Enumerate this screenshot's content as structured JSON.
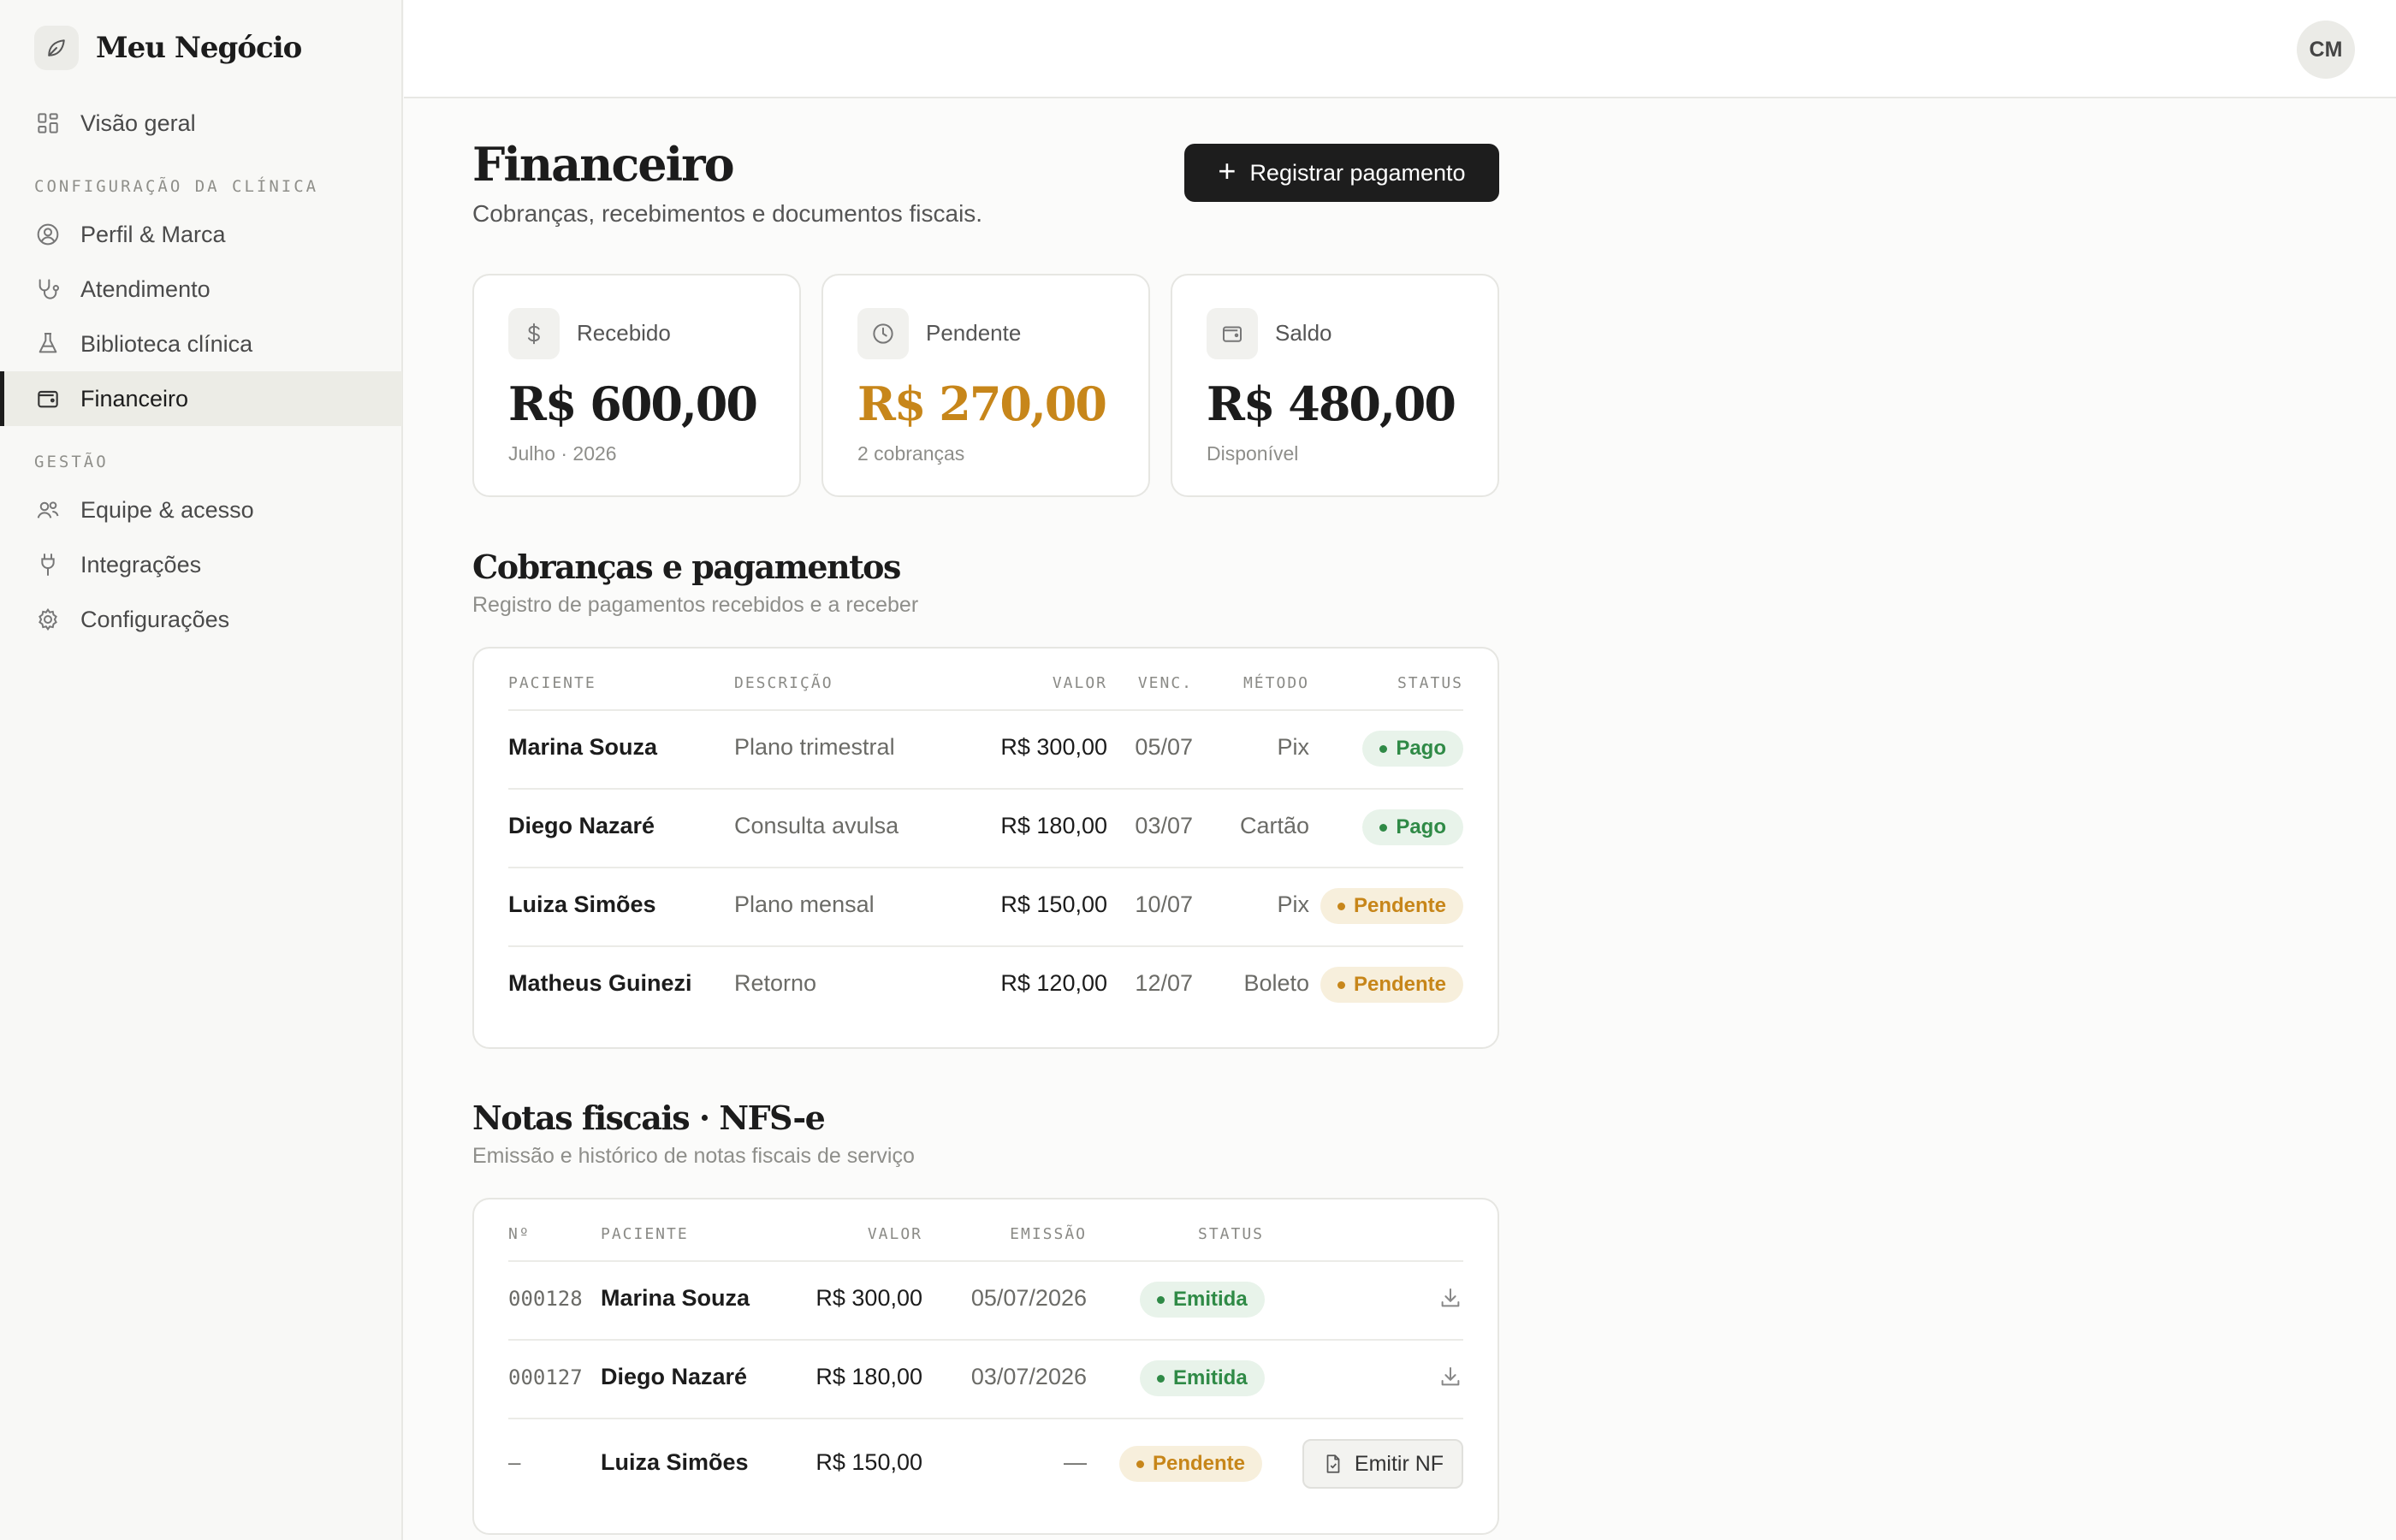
{
  "brand": {
    "name": "Meu Negócio"
  },
  "user": {
    "initials": "CM"
  },
  "sidebar": {
    "overview": "Visão geral",
    "sections": [
      {
        "title": "CONFIGURAÇÃO DA CLÍNICA"
      },
      {
        "title": "GESTÃO"
      }
    ],
    "items": [
      {
        "label": "Perfil & Marca"
      },
      {
        "label": "Atendimento"
      },
      {
        "label": "Biblioteca clínica"
      },
      {
        "label": "Financeiro",
        "active": true
      },
      {
        "label": "Equipe & acesso"
      },
      {
        "label": "Integrações"
      },
      {
        "label": "Configurações"
      }
    ]
  },
  "page": {
    "title": "Financeiro",
    "subtitle": "Cobranças, recebimentos e documentos fiscais.",
    "primary_action": "Registrar pagamento"
  },
  "stats": [
    {
      "label": "Recebido",
      "value": "R$ 600,00",
      "caption": "Julho · 2026",
      "icon": "dollar-icon"
    },
    {
      "label": "Pendente",
      "value": "R$ 270,00",
      "caption": "2 cobranças",
      "icon": "clock-icon",
      "color": "#c7861a"
    },
    {
      "label": "Saldo",
      "value": "R$ 480,00",
      "caption": "Disponível",
      "icon": "wallet-icon"
    }
  ],
  "payments": {
    "title": "Cobranças e pagamentos",
    "subtitle": "Registro de pagamentos recebidos e a receber",
    "columns": {
      "patient": "PACIENTE",
      "description": "DESCRIÇÃO",
      "value": "VALOR",
      "due": "VENC.",
      "method": "MÉTODO",
      "status": "STATUS"
    },
    "rows": [
      {
        "patient": "Marina Souza",
        "description": "Plano trimestral",
        "value": "R$ 300,00",
        "due": "05/07",
        "method": "Pix",
        "status": "Pago"
      },
      {
        "patient": "Diego Nazaré",
        "description": "Consulta avulsa",
        "value": "R$ 180,00",
        "due": "03/07",
        "method": "Cartão",
        "status": "Pago"
      },
      {
        "patient": "Luiza Simões",
        "description": "Plano mensal",
        "value": "R$ 150,00",
        "due": "10/07",
        "method": "Pix",
        "status": "Pendente"
      },
      {
        "patient": "Matheus Guinezi",
        "description": "Retorno",
        "value": "R$ 120,00",
        "due": "12/07",
        "method": "Boleto",
        "status": "Pendente"
      }
    ]
  },
  "invoices": {
    "title": "Notas fiscais · NFS-e",
    "subtitle": "Emissão e histórico de notas fiscais de serviço",
    "columns": {
      "number": "Nº",
      "patient": "PACIENTE",
      "value": "VALOR",
      "issued": "EMISSÃO",
      "status": "STATUS"
    },
    "rows": [
      {
        "number": "000128",
        "patient": "Marina Souza",
        "value": "R$ 300,00",
        "issued": "05/07/2026",
        "status": "Emitida"
      },
      {
        "number": "000127",
        "patient": "Diego Nazaré",
        "value": "R$ 180,00",
        "issued": "03/07/2026",
        "status": "Emitida"
      },
      {
        "number": "—",
        "patient": "Luiza Simões",
        "value": "R$ 150,00",
        "issued": "—",
        "status": "Pendente",
        "action": "Emitir NF"
      }
    ]
  },
  "colors": {
    "accent": "#1d1d1d",
    "success": "#2f8a46",
    "warning": "#c7861a"
  }
}
